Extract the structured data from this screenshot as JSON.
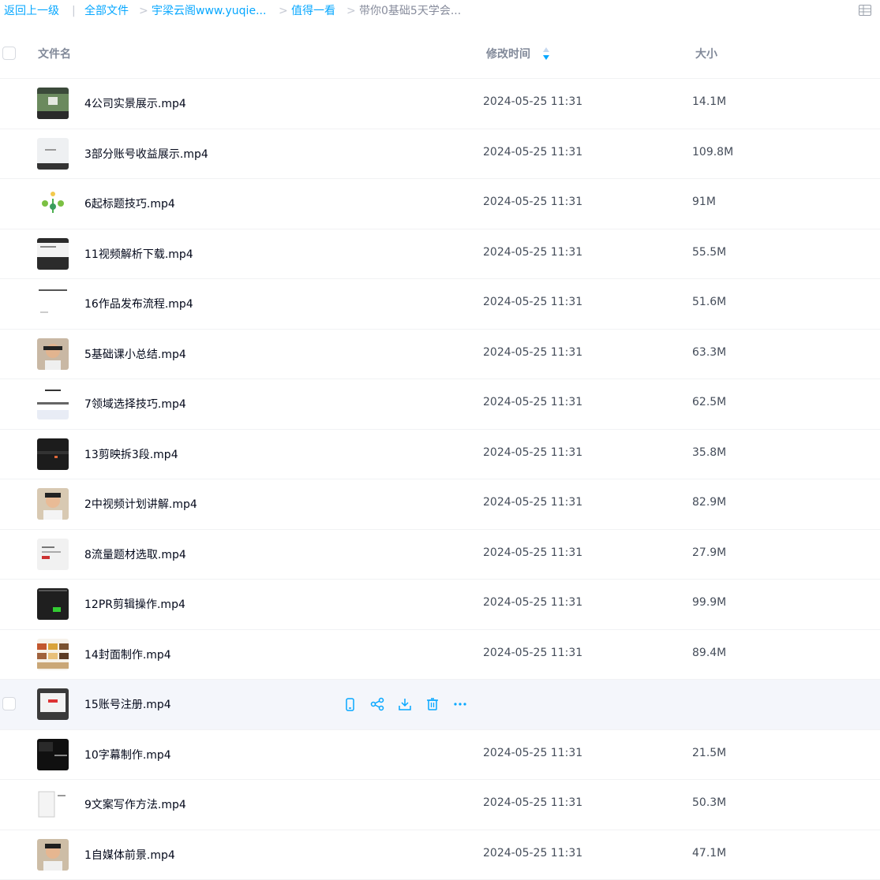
{
  "breadcrumb": {
    "back": "返回上一级",
    "all_files": "全部文件",
    "folder1": "宇梁云阁www.yuqie...",
    "folder2": "值得一看",
    "current": "带你0基础5天学会..."
  },
  "table": {
    "col_name": "文件名",
    "col_time": "修改时间",
    "col_size": "大小"
  },
  "files": [
    {
      "name": "4公司实景展示.mp4",
      "time": "2024-05-25 11:31",
      "size": "14.1M"
    },
    {
      "name": "3部分账号收益展示.mp4",
      "time": "2024-05-25 11:31",
      "size": "109.8M"
    },
    {
      "name": "6起标题技巧.mp4",
      "time": "2024-05-25 11:31",
      "size": "91M"
    },
    {
      "name": "11视频解析下载.mp4",
      "time": "2024-05-25 11:31",
      "size": "55.5M"
    },
    {
      "name": "16作品发布流程.mp4",
      "time": "2024-05-25 11:31",
      "size": "51.6M"
    },
    {
      "name": "5基础课小总结.mp4",
      "time": "2024-05-25 11:31",
      "size": "63.3M"
    },
    {
      "name": "7领域选择技巧.mp4",
      "time": "2024-05-25 11:31",
      "size": "62.5M"
    },
    {
      "name": "13剪映拆3段.mp4",
      "time": "2024-05-25 11:31",
      "size": "35.8M"
    },
    {
      "name": "2中视频计划讲解.mp4",
      "time": "2024-05-25 11:31",
      "size": "82.9M"
    },
    {
      "name": "8流量题材选取.mp4",
      "time": "2024-05-25 11:31",
      "size": "27.9M"
    },
    {
      "name": "12PR剪辑操作.mp4",
      "time": "2024-05-25 11:31",
      "size": "99.9M"
    },
    {
      "name": "14封面制作.mp4",
      "time": "2024-05-25 11:31",
      "size": "89.4M"
    },
    {
      "name": "15账号注册.mp4",
      "time": "",
      "size": ""
    },
    {
      "name": "10字幕制作.mp4",
      "time": "2024-05-25 11:31",
      "size": "21.5M"
    },
    {
      "name": "9文案写作方法.mp4",
      "time": "2024-05-25 11:31",
      "size": "50.3M"
    },
    {
      "name": "1自媒体前景.mp4",
      "time": "2024-05-25 11:31",
      "size": "47.1M"
    }
  ],
  "hover_row_index": 12,
  "hover_actions": [
    "phone-icon",
    "share-icon",
    "download-icon",
    "trash-icon",
    "more-icon"
  ],
  "colors": {
    "accent": "#06a7ff",
    "text": "#03081a",
    "muted": "#454d5a",
    "hover_bg": "#f4f6fb"
  }
}
